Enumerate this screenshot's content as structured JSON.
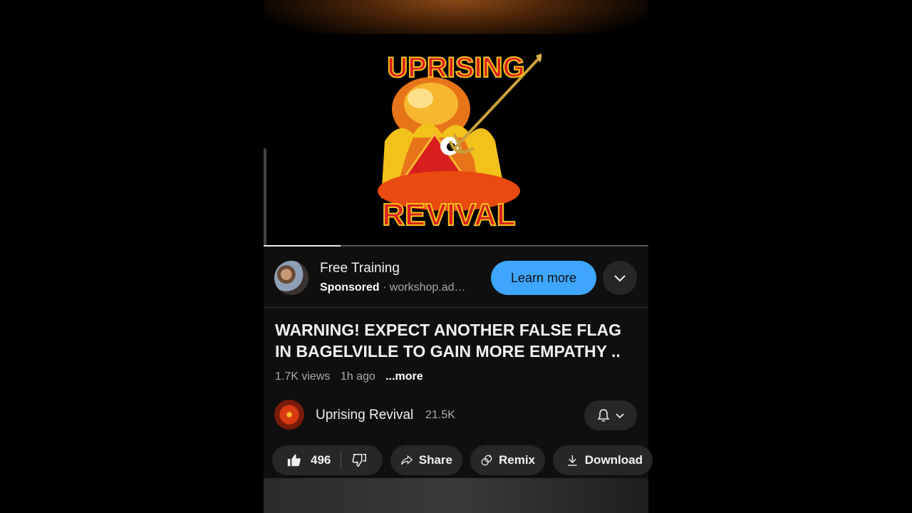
{
  "video": {
    "logo_top_text": "UPRISING",
    "logo_bottom_text": "REVIVAL",
    "progress": 0.2
  },
  "ad": {
    "title": "Free Training",
    "sponsored_label": "Sponsored",
    "separator": "·",
    "domain": "workshop.ad…",
    "cta_label": "Learn more"
  },
  "video_info": {
    "title": "WARNING! EXPECT ANOTHER FALSE FLAG IN BAGELVILLE TO GAIN MORE EMPATHY ..",
    "views": "1.7K views",
    "time_ago": "1h ago",
    "more_label": "...more"
  },
  "channel": {
    "name": "Uprising Revival",
    "subscribers": "21.5K"
  },
  "actions": {
    "like_count": "496",
    "share_label": "Share",
    "remix_label": "Remix",
    "download_label": "Download"
  },
  "colors": {
    "accent": "#3ea6ff",
    "background": "#0f0f0f",
    "pill": "#272727"
  }
}
